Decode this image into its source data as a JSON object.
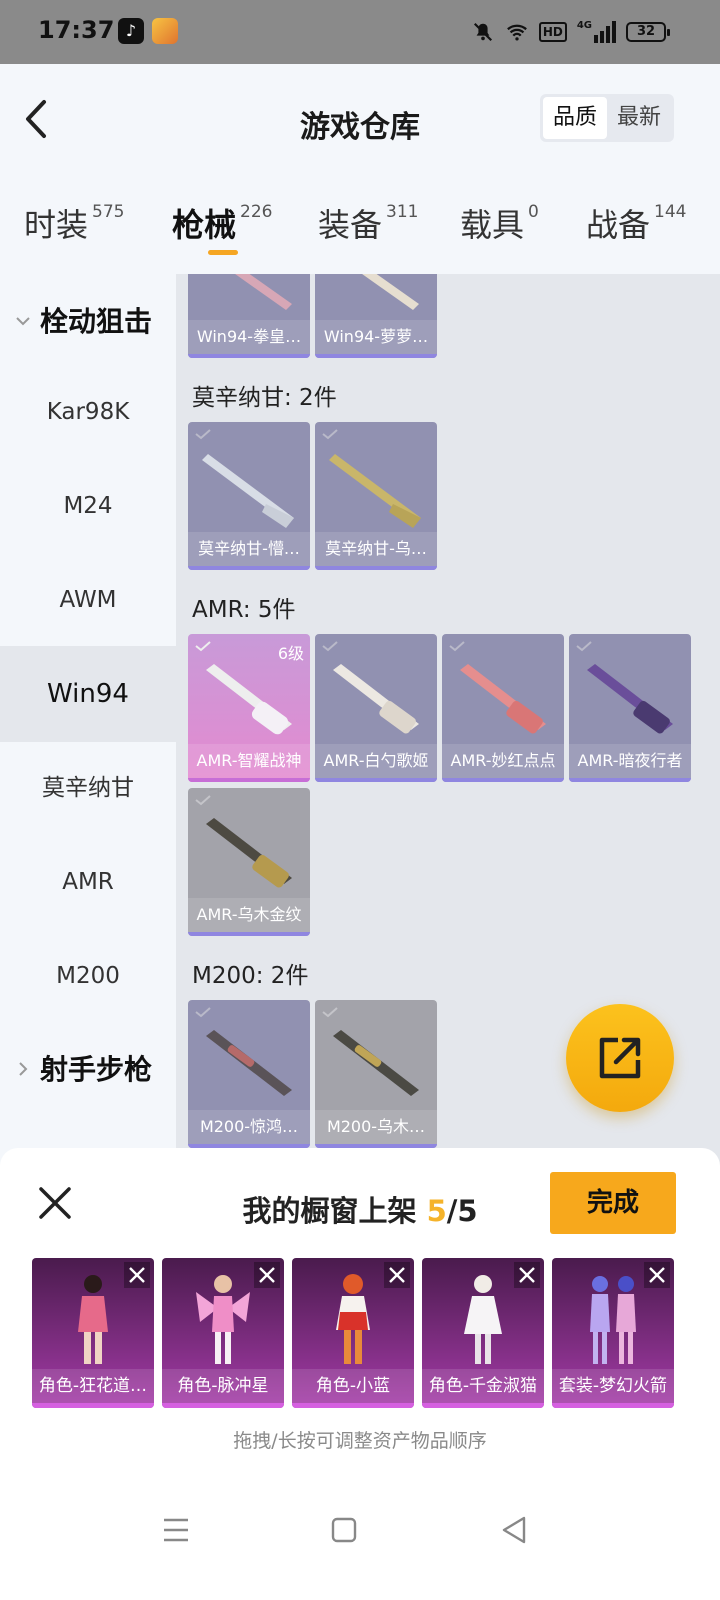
{
  "status_bar": {
    "time": "17:37",
    "tiktok_icon": "tiktok-icon",
    "game_icon": "game-app-icon",
    "mute_icon": "bell-mute-icon",
    "wifi_icon": "wifi-icon",
    "hd_badge": "HD",
    "network": "4G",
    "battery": "32"
  },
  "header": {
    "title": "游戏仓库",
    "back_icon": "back-chevron-icon",
    "sort_options": [
      "品质",
      "最新"
    ],
    "sort_active": "品质"
  },
  "categories": [
    {
      "label": "时装",
      "count": "575"
    },
    {
      "label": "枪械",
      "count": "226",
      "active": true
    },
    {
      "label": "装备",
      "count": "311"
    },
    {
      "label": "载具",
      "count": "0"
    },
    {
      "label": "战备",
      "count": "144"
    }
  ],
  "sidebar": {
    "group_open": "栓动狙击",
    "items": [
      "Kar98K",
      "M24",
      "AWM",
      "Win94",
      "莫辛纳甘",
      "AMR",
      "M200"
    ],
    "active_item": "Win94",
    "group_closed": "射手步枪"
  },
  "inventory": {
    "win94_items": [
      {
        "name": "Win94-拳皇…"
      },
      {
        "name": "Win94-萝萝…"
      }
    ],
    "mosin": {
      "title": "莫辛纳甘: 2件",
      "items": [
        {
          "name": "莫辛纳甘-懵…"
        },
        {
          "name": "莫辛纳甘-乌…"
        }
      ]
    },
    "amr": {
      "title": "AMR: 5件",
      "items": [
        {
          "name": "AMR-智耀战神",
          "level": "6级"
        },
        {
          "name": "AMR-白勺歌姬"
        },
        {
          "name": "AMR-妙红点点"
        },
        {
          "name": "AMR-暗夜行者"
        },
        {
          "name": "AMR-乌木金纹"
        }
      ]
    },
    "m200": {
      "title": "M200: 2件",
      "items": [
        {
          "name": "M200-惊鸿…"
        },
        {
          "name": "M200-乌木…"
        }
      ]
    }
  },
  "fab": {
    "icon": "share-export-icon"
  },
  "showcase": {
    "title": "我的橱窗上架",
    "current": "5",
    "separator": "/",
    "total": "5",
    "done_label": "完成",
    "close_icon": "close-icon",
    "slots": [
      {
        "name": "角色-狂花道…"
      },
      {
        "name": "角色-脉冲星"
      },
      {
        "name": "角色-小蓝"
      },
      {
        "name": "角色-千金淑猫"
      },
      {
        "name": "套装-梦幻火箭"
      }
    ],
    "hint": "拖拽/长按可调整资产物品顺序"
  },
  "nav": {
    "menu_icon": "menu-icon",
    "home_icon": "home-square-icon",
    "back_icon": "back-triangle-icon"
  }
}
